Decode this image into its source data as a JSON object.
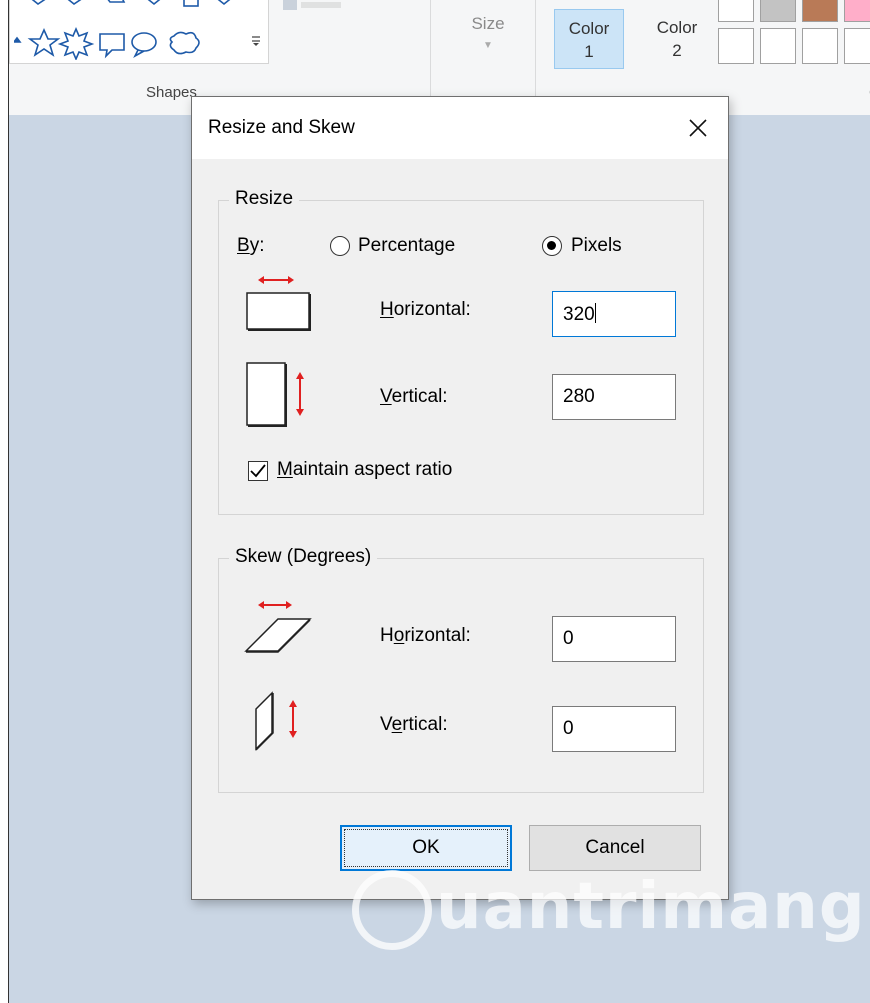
{
  "ribbon": {
    "shapes_label": "Shapes",
    "size_label": "Size",
    "color1_label": "Color",
    "color1_num": "1",
    "color2_label": "Color",
    "color2_num": "2",
    "colors_label": "C"
  },
  "dialog": {
    "title": "Resize and Skew",
    "resize_group": {
      "legend": "Resize",
      "by_label": "By:",
      "percentage_label": "Percentage",
      "pixels_label": "Pixels",
      "selected_unit": "Pixels",
      "horizontal_label": "Horizontal:",
      "horizontal_value": "320",
      "vertical_label": "Vertical:",
      "vertical_value": "280",
      "maintain_label": "Maintain aspect ratio",
      "maintain_checked": true
    },
    "skew_group": {
      "legend": "Skew (Degrees)",
      "horizontal_label": "Horizontal:",
      "horizontal_value": "0",
      "vertical_label": "Vertical:",
      "vertical_value": "0"
    },
    "ok_label": "OK",
    "cancel_label": "Cancel"
  },
  "watermark": {
    "text": "uantrimang"
  },
  "colors": {
    "accent": "#0078d7",
    "arrow_red": "#e02020",
    "canvas": "#cad6e4",
    "shape_blue": "#1e5aa8"
  }
}
